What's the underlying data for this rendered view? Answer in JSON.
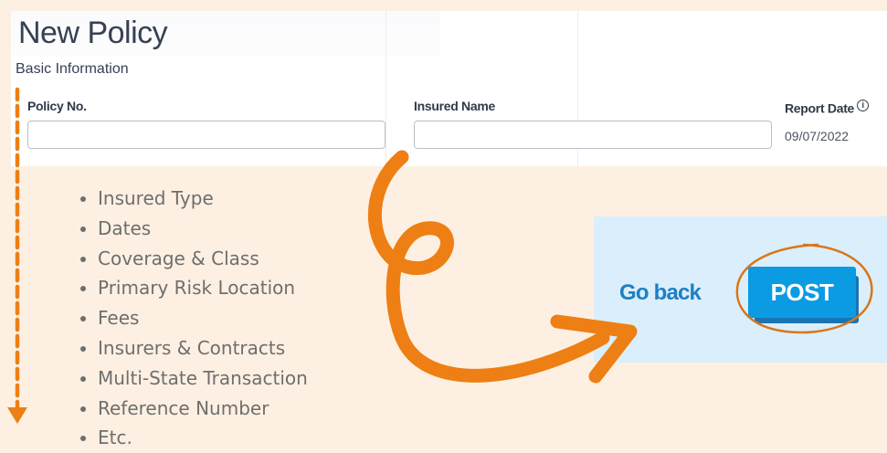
{
  "form": {
    "title": "New Policy",
    "section_title": "Basic Information",
    "fields": {
      "policy_no": {
        "label": "Policy No.",
        "value": ""
      },
      "insured_name": {
        "label": "Insured Name",
        "value": ""
      },
      "report_date": {
        "label": "Report Date",
        "value": "09/07/2022",
        "info_icon": "info-icon"
      }
    }
  },
  "bullet_list": [
    "Insured Type",
    "Dates",
    "Coverage & Class",
    "Primary Risk Location",
    "Fees",
    "Insurers & Contracts",
    "Multi-State Transaction",
    "Reference Number",
    "Etc."
  ],
  "actions": {
    "go_back_label": "Go back",
    "post_label": "POST"
  },
  "colors": {
    "background": "#fdf0e2",
    "annotation_orange": "#ee7f14",
    "primary_button": "#0a9be3",
    "link_blue": "#1d7fc4",
    "action_panel": "#dbeefb"
  }
}
